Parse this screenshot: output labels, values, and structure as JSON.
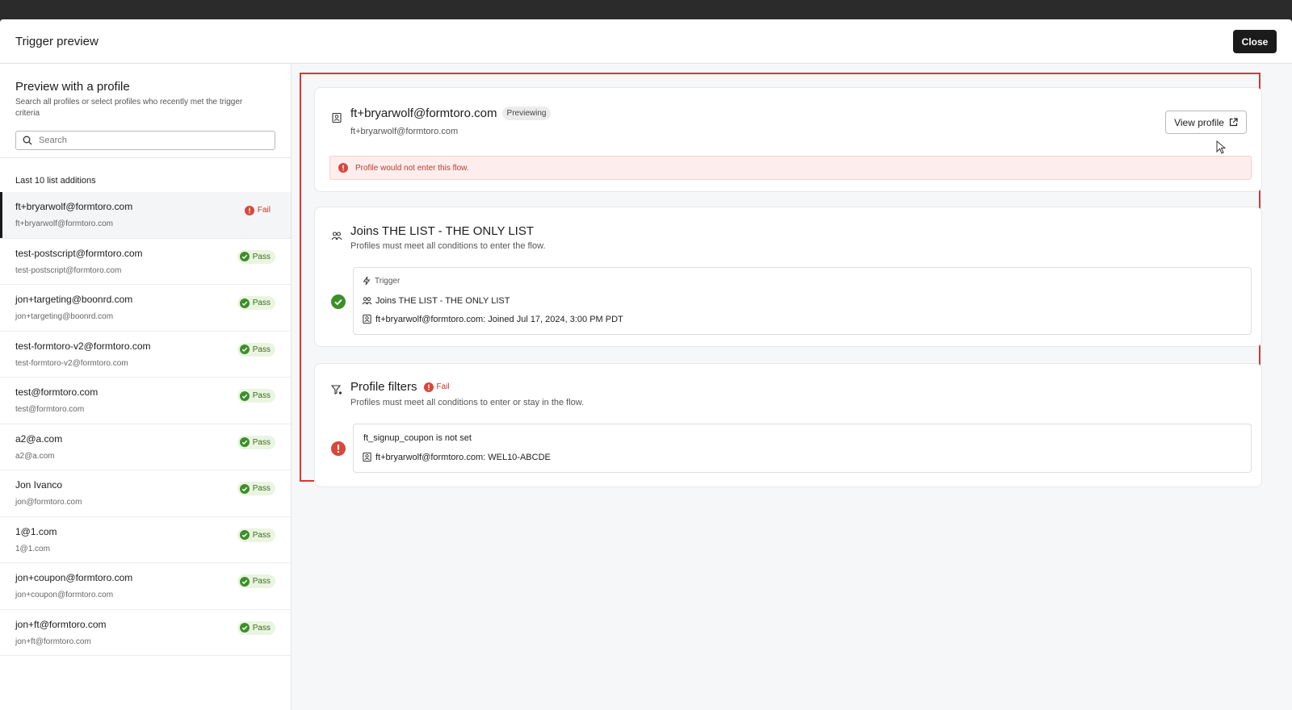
{
  "modal": {
    "title": "Trigger preview",
    "close_label": "Close"
  },
  "sidebar": {
    "title": "Preview with a profile",
    "subtitle": "Search all profiles or select profiles who recently met the trigger criteria",
    "search_placeholder": "Search",
    "list_label": "Last 10 list additions",
    "items": [
      {
        "name": "ft+bryarwolf@formtoro.com",
        "email": "ft+bryarwolf@formtoro.com",
        "status": "Fail"
      },
      {
        "name": "test-postscript@formtoro.com",
        "email": "test-postscript@formtoro.com",
        "status": "Pass"
      },
      {
        "name": "jon+targeting@boonrd.com",
        "email": "jon+targeting@boonrd.com",
        "status": "Pass"
      },
      {
        "name": "test-formtoro-v2@formtoro.com",
        "email": "test-formtoro-v2@formtoro.com",
        "status": "Pass"
      },
      {
        "name": "test@formtoro.com",
        "email": "test@formtoro.com",
        "status": "Pass"
      },
      {
        "name": "a2@a.com",
        "email": "a2@a.com",
        "status": "Pass"
      },
      {
        "name": "Jon Ivanco",
        "email": "jon@formtoro.com",
        "status": "Pass"
      },
      {
        "name": "1@1.com",
        "email": "1@1.com",
        "status": "Pass"
      },
      {
        "name": "jon+coupon@formtoro.com",
        "email": "jon+coupon@formtoro.com",
        "status": "Pass"
      },
      {
        "name": "jon+ft@formtoro.com",
        "email": "jon+ft@formtoro.com",
        "status": "Pass"
      }
    ]
  },
  "profile_card": {
    "title": "ft+bryarwolf@formtoro.com",
    "previewing_tag": "Previewing",
    "email": "ft+bryarwolf@formtoro.com",
    "view_profile_label": "View profile",
    "alert": "Profile would not enter this flow."
  },
  "trigger_card": {
    "title": "Joins THE LIST - THE ONLY LIST",
    "subtitle": "Profiles must meet all conditions to enter the flow.",
    "trigger_label": "Trigger",
    "list_row": "Joins THE LIST - THE ONLY LIST",
    "joined_row": "ft+bryarwolf@formtoro.com: Joined Jul 17, 2024, 3:00 PM PDT"
  },
  "filters_card": {
    "title": "Profile filters",
    "status": "Fail",
    "subtitle": "Profiles must meet all conditions to enter or stay in the flow.",
    "condition": "ft_signup_coupon is not set",
    "value_row": "ft+bryarwolf@formtoro.com: WEL10-ABCDE"
  },
  "colors": {
    "pass": "#3d8f2a",
    "fail": "#d9473b",
    "accent": "#1b1b1b",
    "highlight_frame": "#d93636"
  }
}
